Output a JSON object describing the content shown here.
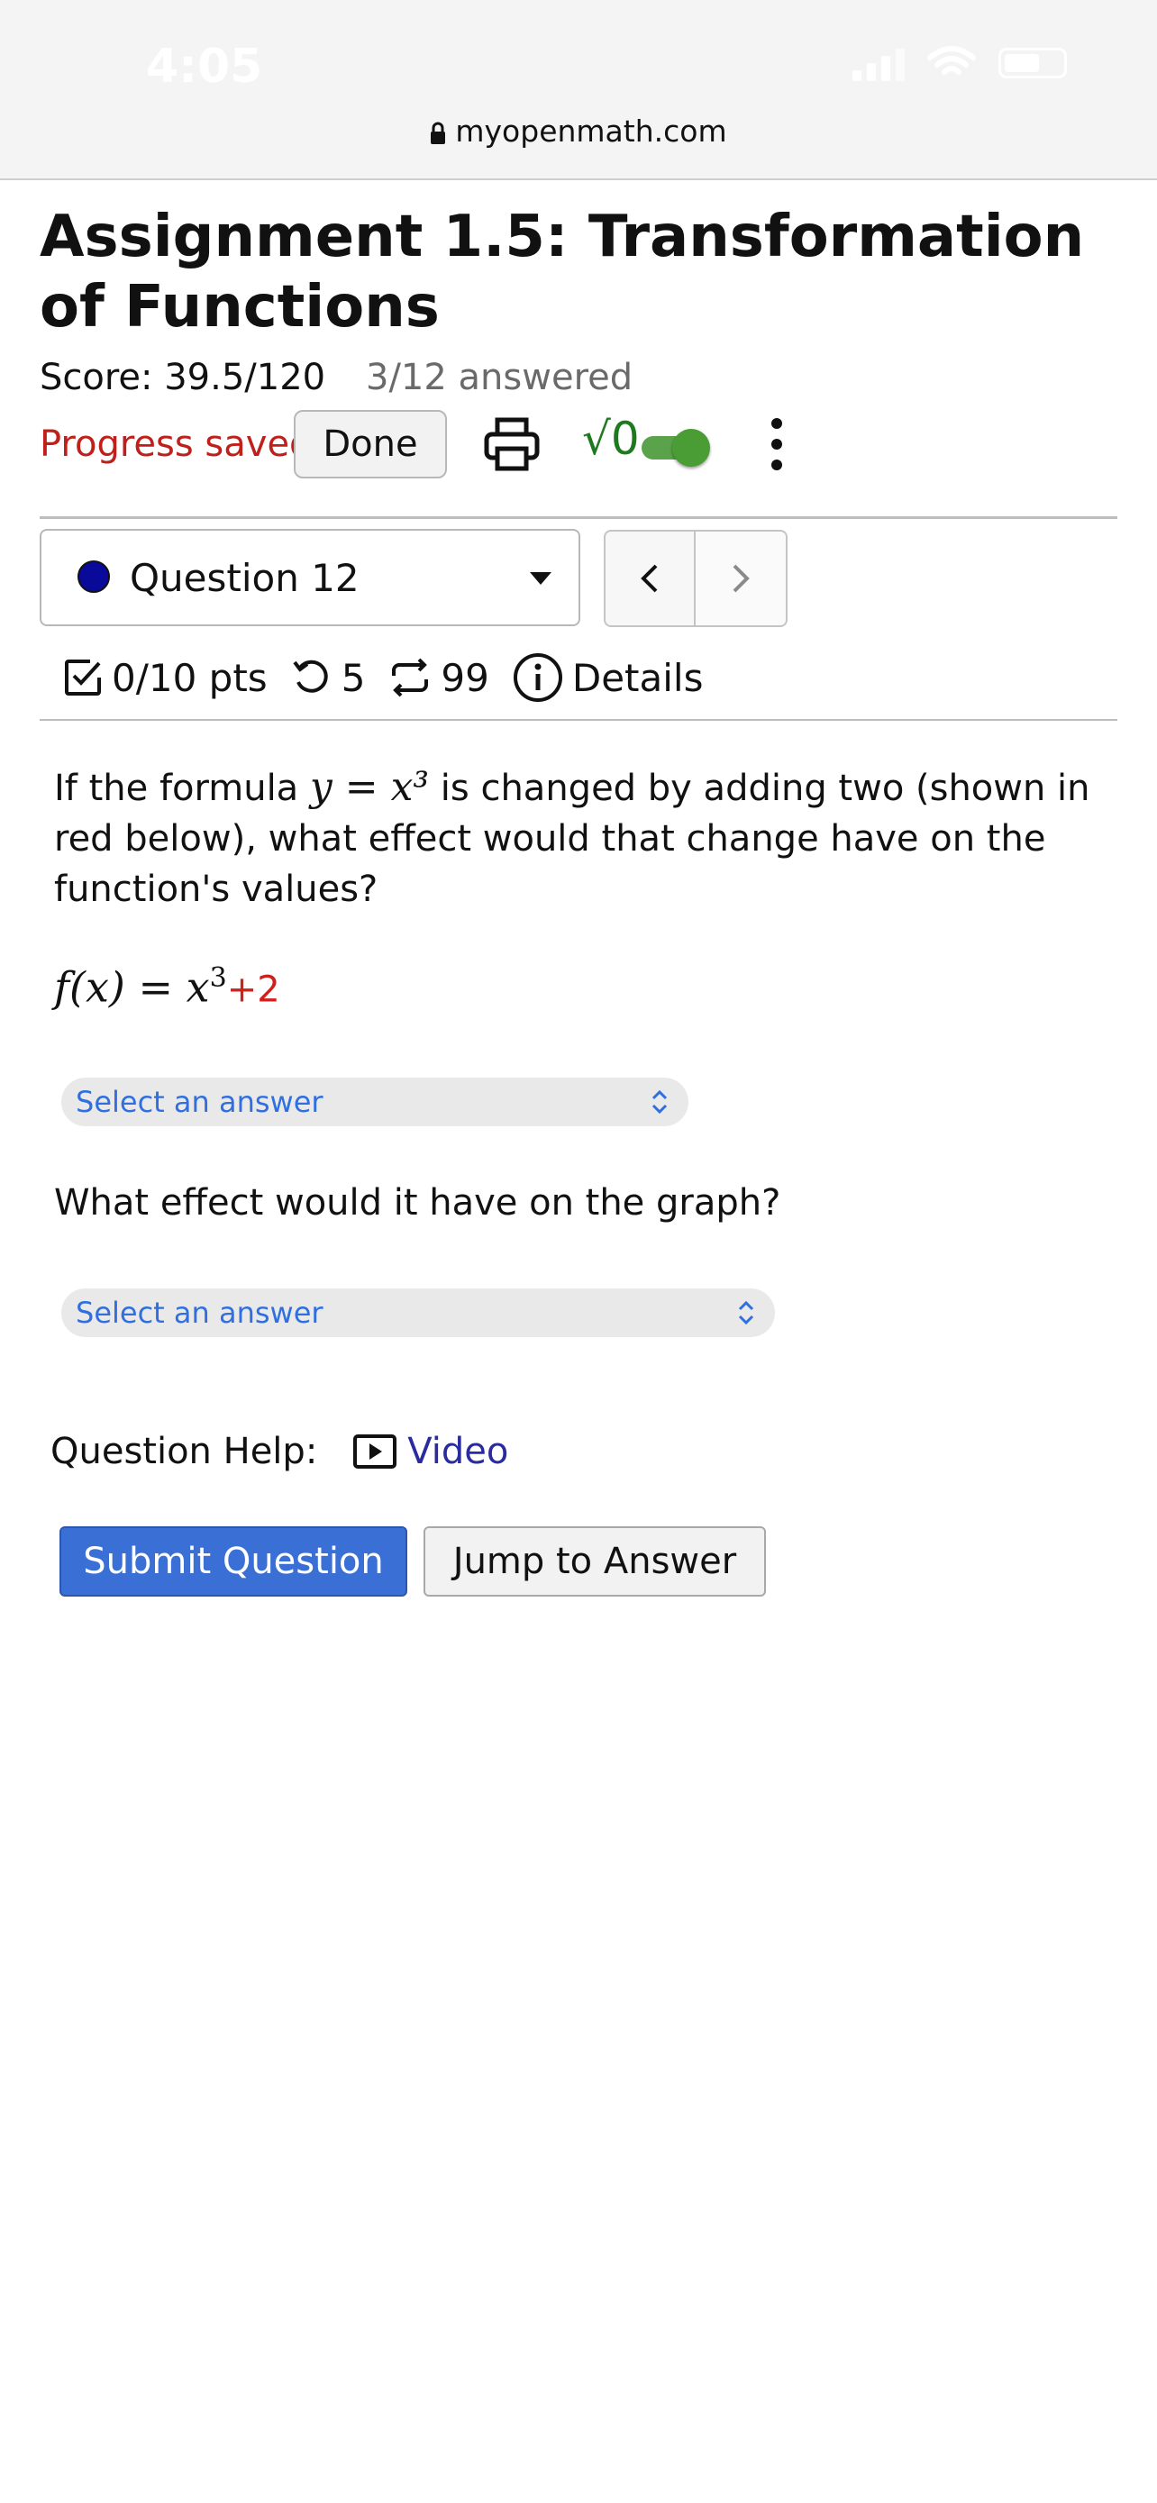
{
  "status_bar": {
    "time": "4:05"
  },
  "browser": {
    "url": "myopenmath.com"
  },
  "assignment": {
    "title": "Assignment 1.5: Transformation of Functions",
    "score": "Score: 39.5/120",
    "answered": "3/12 answered",
    "progress": "Progress saved",
    "done_label": "Done",
    "sqrt_label": "√0",
    "toggle_on": true
  },
  "question_nav": {
    "selected": "Question 12",
    "points": "0/10 pts",
    "retries": "5",
    "attempts": "99",
    "details": "Details"
  },
  "question": {
    "text_part1": "If the formula",
    "math_inline": "y = x³",
    "text_part2": "is changed by adding two (shown in red below), what effect would that change have on the function's values?",
    "formula_main": "f(x) = x",
    "formula_exp": "3",
    "formula_added": "+2",
    "select1_placeholder": "Select an answer",
    "question2": "What effect would it have on the graph?",
    "select2_placeholder": "Select an answer"
  },
  "help": {
    "label": "Question Help:",
    "video": "Video"
  },
  "actions": {
    "submit": "Submit Question",
    "jump": "Jump to Answer"
  },
  "colors": {
    "accent": "#3a6fd6",
    "saved_red": "#c0201b",
    "toggle_green": "#4a9c34",
    "link": "#2b2ba0"
  }
}
